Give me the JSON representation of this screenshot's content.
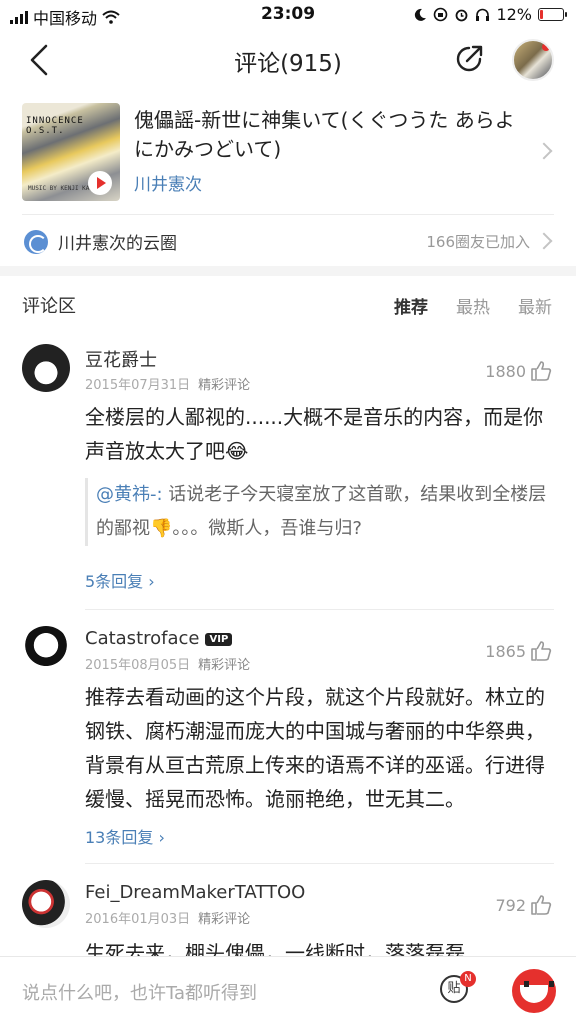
{
  "status": {
    "carrier": "中国移动",
    "time": "23:09",
    "battery": "12%",
    "battery_level": 0.12
  },
  "nav": {
    "title": "评论(915)"
  },
  "song": {
    "cover_title": "INNOCENCE O.S.T.",
    "cover_sub": "MUSIC BY KENJI KAWAI",
    "name": "傀儡謡-新世に神集いて(くぐつうた あらよにかみつどいて)",
    "artist": "川井憲次"
  },
  "circle": {
    "name": "川井憲次的云圈",
    "count": "166圈友已加入"
  },
  "section": {
    "title": "评论区",
    "tabs": [
      "推荐",
      "最热",
      "最新"
    ]
  },
  "comments": [
    {
      "user": "豆花爵士",
      "date": "2015年07月31日",
      "tag": "精彩评论",
      "likes": "1880",
      "text": "全楼层的人鄙视的......大概不是音乐的内容，而是你声音放太大了吧😂",
      "quote_user": "@黄祎-:",
      "quote_text": " 话说老子今天寝室放了这首歌，结果收到全楼层的鄙视👎。。。微斯人，吾谁与归?",
      "replies": "5条回复 ›"
    },
    {
      "user": "Catastroface",
      "vip": "VIP",
      "date": "2015年08月05日",
      "tag": "精彩评论",
      "likes": "1865",
      "text": "推荐去看动画的这个片段，就这个片段就好。林立的钢铁、腐朽潮湿而庞大的中国城与奢丽的中华祭典，背景有从亘古荒原上传来的语焉不详的巫谣。行进得缓慢、摇晃而恐怖。诡丽艳绝，世无其二。",
      "replies": "13条回复 ›"
    },
    {
      "user": "Fei_DreamMakerTATTOO",
      "date": "2016年01月03日",
      "tag": "精彩评论",
      "likes": "792",
      "text": "生死去来，棚头傀儡，一线断时，落落磊磊"
    }
  ],
  "bottom": {
    "placeholder": "说点什么吧，也许Ta都听得到",
    "post_label": "贴",
    "badge": "N"
  },
  "colors": {
    "accent": "#e5302d",
    "link": "#4a7fb6"
  }
}
